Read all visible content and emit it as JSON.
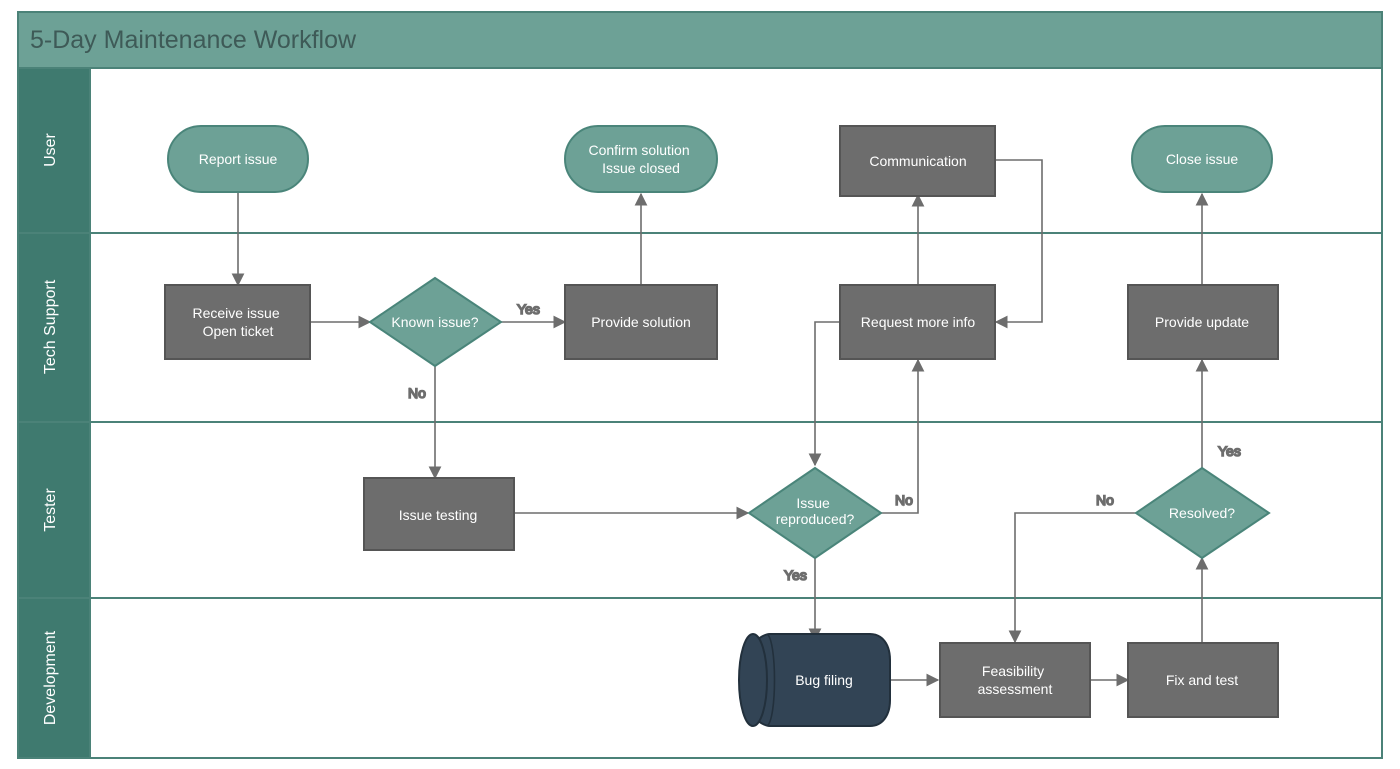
{
  "title": "5-Day Maintenance Workflow",
  "lanes": [
    {
      "id": "user",
      "label": "User"
    },
    {
      "id": "techsupport",
      "label": "Tech Support"
    },
    {
      "id": "tester",
      "label": "Tester"
    },
    {
      "id": "development",
      "label": "Development"
    }
  ],
  "nodes": {
    "report_issue": {
      "text": "Report issue",
      "type": "terminator",
      "lane": "user"
    },
    "confirm_closed": {
      "text": "Confirm solution\nIssue closed",
      "type": "terminator",
      "lane": "user"
    },
    "communication": {
      "text": "Communication",
      "type": "process",
      "lane": "user"
    },
    "close_issue": {
      "text": "Close issue",
      "type": "terminator",
      "lane": "user"
    },
    "receive_issue": {
      "text": "Receive issue\nOpen ticket",
      "type": "process",
      "lane": "techsupport"
    },
    "known_issue": {
      "text": "Known issue?",
      "type": "decision",
      "lane": "techsupport"
    },
    "provide_solution": {
      "text": "Provide solution",
      "type": "process",
      "lane": "techsupport"
    },
    "request_info": {
      "text": "Request more info",
      "type": "process",
      "lane": "techsupport"
    },
    "provide_update": {
      "text": "Provide update",
      "type": "process",
      "lane": "techsupport"
    },
    "issue_testing": {
      "text": "Issue testing",
      "type": "process",
      "lane": "tester"
    },
    "issue_reproduced": {
      "text": "Issue\nreproduced?",
      "type": "decision",
      "lane": "tester"
    },
    "resolved": {
      "text": "Resolved?",
      "type": "decision",
      "lane": "tester"
    },
    "bug_filing": {
      "text": "Bug filing",
      "type": "datastore",
      "lane": "development"
    },
    "feasibility": {
      "text": "Feasibility\nassessment",
      "type": "process",
      "lane": "development"
    },
    "fix_and_test": {
      "text": "Fix and test",
      "type": "process",
      "lane": "development"
    }
  },
  "edges": [
    {
      "from": "report_issue",
      "to": "receive_issue",
      "label": ""
    },
    {
      "from": "receive_issue",
      "to": "known_issue",
      "label": ""
    },
    {
      "from": "known_issue",
      "to": "provide_solution",
      "label": "Yes"
    },
    {
      "from": "known_issue",
      "to": "issue_testing",
      "label": "No"
    },
    {
      "from": "provide_solution",
      "to": "confirm_closed",
      "label": ""
    },
    {
      "from": "issue_testing",
      "to": "issue_reproduced",
      "label": ""
    },
    {
      "from": "issue_reproduced",
      "to": "request_info",
      "label": "No"
    },
    {
      "from": "issue_reproduced",
      "to": "bug_filing",
      "label": "Yes"
    },
    {
      "from": "request_info",
      "to": "communication",
      "label": ""
    },
    {
      "from": "communication",
      "to": "request_info",
      "label": ""
    },
    {
      "from": "bug_filing",
      "to": "feasibility",
      "label": ""
    },
    {
      "from": "feasibility",
      "to": "fix_and_test",
      "label": ""
    },
    {
      "from": "fix_and_test",
      "to": "resolved",
      "label": ""
    },
    {
      "from": "resolved",
      "to": "feasibility",
      "label": "No"
    },
    {
      "from": "resolved",
      "to": "provide_update",
      "label": "Yes"
    },
    {
      "from": "provide_update",
      "to": "close_issue",
      "label": ""
    }
  ],
  "colors": {
    "header_bg": "#6da196",
    "lane_bg": "#3f7a6f",
    "node_green": "#6da196",
    "node_gray": "#6d6d6d",
    "node_dark": "#324455",
    "stroke": "#6d6d6d",
    "lane_border": "#4b8278"
  }
}
